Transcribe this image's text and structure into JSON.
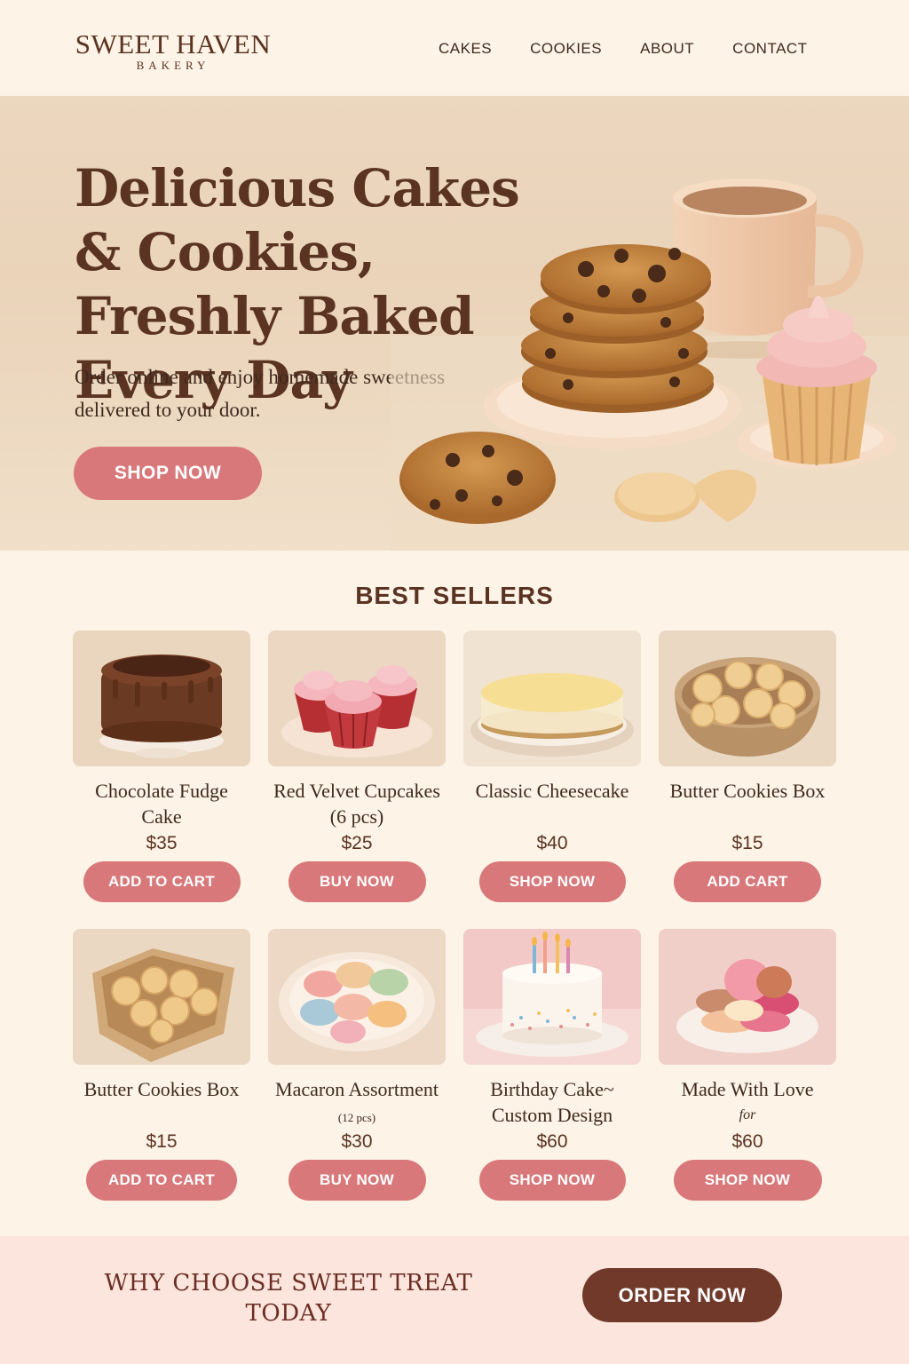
{
  "brand": {
    "name": "SWEET HAVEN",
    "sub": "BAKERY"
  },
  "nav": [
    "CAKES",
    "COOKIES",
    "ABOUT",
    "CONTACT"
  ],
  "hero": {
    "title": "Delicious Cakes & Cookies, Freshly Baked Every Day",
    "subtitle": "Order online and enjoy homemade sweetness delivered to your door.",
    "button": "SHOP NOW"
  },
  "best_sellers": {
    "title": "BEST SELLERS",
    "products": [
      {
        "name": "Chocolate Fudge Cake",
        "price": "$35",
        "button": "ADD TO CART",
        "image": "chocolate-cake-image"
      },
      {
        "name": "Red Velvet Cupcakes (6 pcs)",
        "price": "$25",
        "button": "BUY NOW",
        "image": "red-velvet-cupcakes-image"
      },
      {
        "name": "Classic Cheesecake",
        "price": "$40",
        "button": "SHOP NOW",
        "image": "cheesecake-image"
      },
      {
        "name": "Butter Cookies Box",
        "price": "$15",
        "button": "ADD CART",
        "image": "butter-cookies-bowl-image"
      },
      {
        "name": "Butter Cookies Box",
        "price": "$15",
        "button": "ADD TO CART",
        "image": "butter-cookies-box-image"
      },
      {
        "name": "Macaron Assortment",
        "name_small": "(12 pcs)",
        "price": "$30",
        "button": "BUY NOW",
        "image": "macarons-image"
      },
      {
        "name": "Birthday Cake~ Custom Design",
        "price": "$60",
        "button": "SHOP NOW",
        "image": "birthday-cake-image"
      },
      {
        "name": "Made With Love",
        "name_line2": "for",
        "price": "$60",
        "button": "SHOP NOW",
        "image": "sweets-plate-image"
      }
    ]
  },
  "why": {
    "text": "WHY CHOOSE SWEET TREAT TODAY",
    "button": "ORDER NOW"
  },
  "colors": {
    "background": "#fdf3e6",
    "accent": "#d9787a",
    "brown": "#5a3322",
    "banner": "#fce5dc",
    "order_button": "#70392a"
  }
}
